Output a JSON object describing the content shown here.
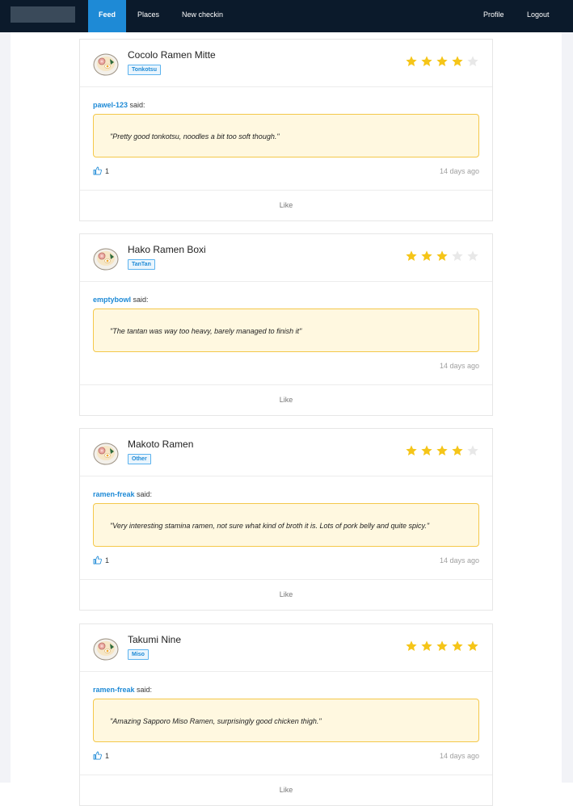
{
  "nav": {
    "feed": "Feed",
    "places": "Places",
    "new_checkin": "New checkin",
    "profile": "Profile",
    "logout": "Logout"
  },
  "colors": {
    "accent": "#1e8ad6",
    "star_on": "#f5c518",
    "star_off": "#e8e8e8",
    "quote_bg": "#fff8e0"
  },
  "feed": [
    {
      "place": "Cocolo Ramen Mitte",
      "tag": "Tonkotsu",
      "rating": 4,
      "user": "pawel-123",
      "said": "said:",
      "comment": "\"Pretty good tonkotsu, noodles a bit too soft though.\"",
      "likes": "1",
      "time_ago": "14 days ago",
      "like_label": "Like"
    },
    {
      "place": "Hako Ramen Boxi",
      "tag": "TanTan",
      "rating": 3,
      "user": "emptybowl",
      "said": "said:",
      "comment": "\"The tantan was way too heavy, barely managed to finish it\"",
      "likes": "",
      "time_ago": "14 days ago",
      "like_label": "Like"
    },
    {
      "place": "Makoto Ramen",
      "tag": "Other",
      "rating": 4,
      "user": "ramen-freak",
      "said": "said:",
      "comment": "\"Very interesting stamina ramen, not sure what kind of broth it is. Lots of pork belly and quite spicy.\"",
      "likes": "1",
      "time_ago": "14 days ago",
      "like_label": "Like"
    },
    {
      "place": "Takumi Nine",
      "tag": "Miso",
      "rating": 5,
      "user": "ramen-freak",
      "said": "said:",
      "comment": "\"Amazing Sapporo Miso Ramen, surprisingly good chicken thigh.\"",
      "likes": "1",
      "time_ago": "14 days ago",
      "like_label": "Like"
    }
  ]
}
